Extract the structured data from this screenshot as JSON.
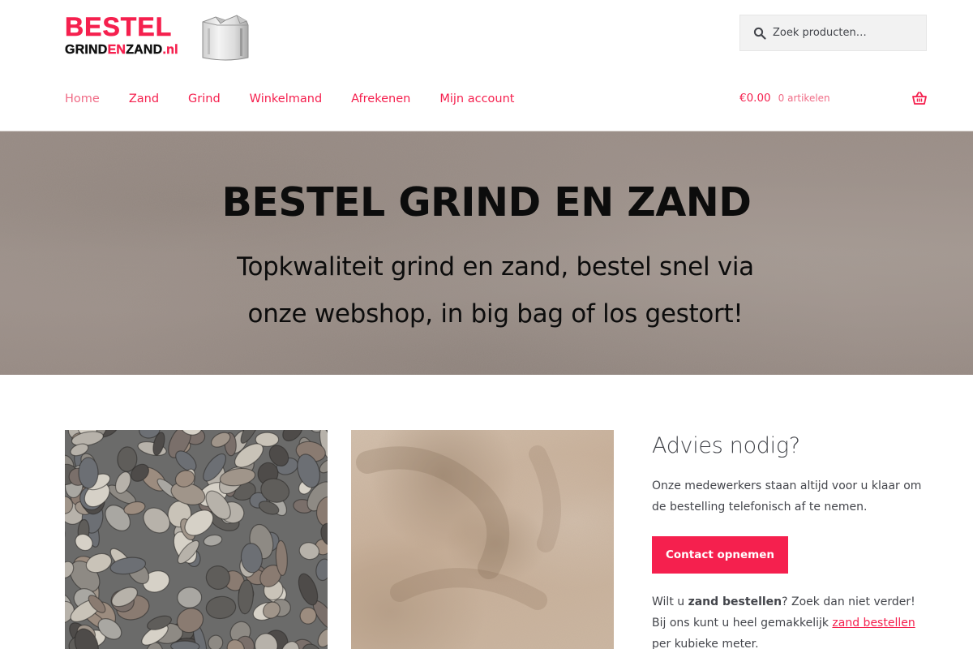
{
  "colors": {
    "accent": "#f5204e",
    "text": "#43454b",
    "hero_bg": "#9c8f88"
  },
  "header": {
    "logo": {
      "line1": "BESTEL",
      "line2_part1": "GRIND",
      "line2_part2": "EN",
      "line2_part3": "ZAND",
      "line2_part4": ".nl"
    },
    "search": {
      "placeholder": "Zoek producten…",
      "icon": "search-icon"
    }
  },
  "nav": {
    "items": [
      {
        "label": "Home"
      },
      {
        "label": "Zand"
      },
      {
        "label": "Grind"
      },
      {
        "label": "Winkelmand"
      },
      {
        "label": "Afrekenen"
      },
      {
        "label": "Mijn account"
      }
    ]
  },
  "cart": {
    "amount": "€0.00",
    "count": "0 artikelen",
    "icon": "shopping-basket-icon"
  },
  "hero": {
    "title": "BESTEL GRIND EN ZAND",
    "subtitle": "Topkwaliteit grind en zand, bestel snel via onze webshop, in big bag of los gestort!"
  },
  "sidebar": {
    "title": "Advies nodig?",
    "text": "Onze medewerkers staan altijd voor u klaar om de bestelling telefonisch af te nemen.",
    "button_label": "Contact opnemen",
    "order_text": {
      "part1": "Wilt u ",
      "bold": "zand bestellen",
      "part2": "? Zoek dan niet verder! Bij ons kunt u heel gemakkelijk ",
      "link": "zand bestellen",
      "part3": " per kubieke meter."
    }
  }
}
